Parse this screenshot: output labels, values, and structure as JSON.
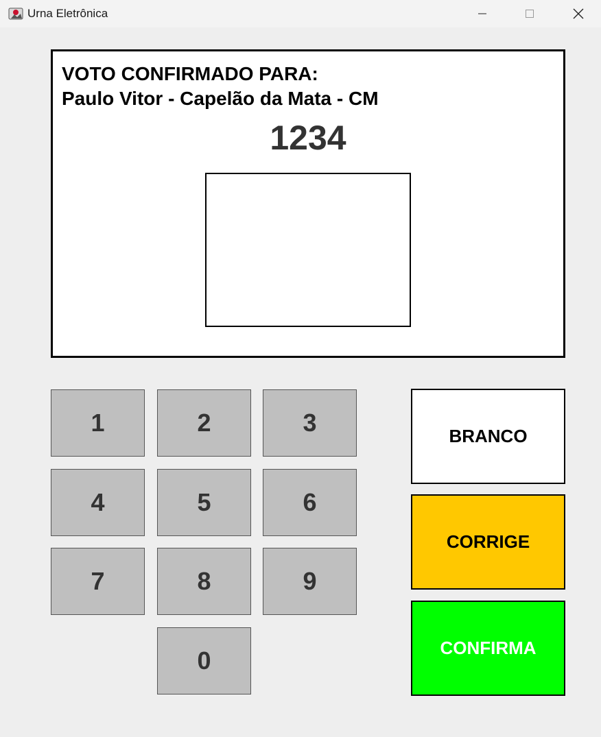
{
  "window": {
    "title": "Urna Eletrônica",
    "icon": "java-app-icon",
    "controls": [
      "minimize-icon",
      "maximize-icon",
      "close-icon"
    ]
  },
  "screen": {
    "heading": "VOTO CONFIRMADO PARA:",
    "candidate": "Paulo Vitor - Capelão da Mata - CM",
    "number": "1234"
  },
  "keypad": {
    "keys": [
      "1",
      "2",
      "3",
      "4",
      "5",
      "6",
      "7",
      "8",
      "9",
      "0"
    ]
  },
  "actions": {
    "branco": "BRANCO",
    "corrige": "CORRIGE",
    "confirma": "CONFIRMA"
  },
  "colors": {
    "key_bg": "#bfbfbf",
    "branco_bg": "#ffffff",
    "corrige_bg": "#ffc800",
    "confirma_bg": "#00ff00"
  }
}
